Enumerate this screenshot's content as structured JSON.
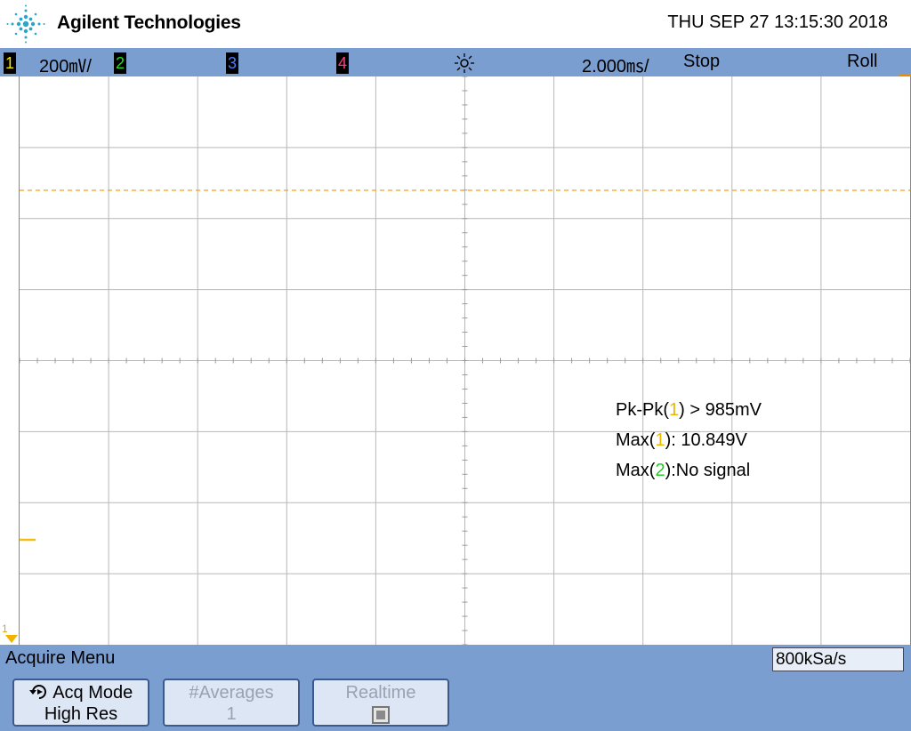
{
  "header": {
    "brand": "Agilent Technologies",
    "datetime": "THU SEP 27 13:15:30 2018",
    "logo_icon": "agilent-spark-icon"
  },
  "status": {
    "ch1": "1",
    "ch1_scale": "200㎷/",
    "ch2": "2",
    "ch3": "3",
    "ch4": "4",
    "trigger_icon": "trigger-sun-icon",
    "timebase": "2.000㎳/",
    "run_state": "Stop",
    "mode": "Roll",
    "colors": {
      "ch1": "#f5e600",
      "ch2": "#22dd22",
      "ch3": "#4a7bff",
      "ch4": "#ff3d8a"
    }
  },
  "screen": {
    "ground_marker": "1",
    "trace_color": "#f2c010"
  },
  "measurements": {
    "pkpk_label": "Pk-Pk(",
    "pkpk_ch": "1",
    "pkpk_value": ") > 985mV",
    "max1_label": "Max(",
    "max1_ch": "1",
    "max1_value": "): 10.849V",
    "max2_label": "Max(",
    "max2_ch": "2",
    "max2_value": "):No signal"
  },
  "menu": {
    "title": "Acquire Menu",
    "sample_rate": "800kSa/s",
    "acq_mode_label": "Acq Mode",
    "acq_mode_value": "High Res",
    "averages_label": "#Averages",
    "averages_value": "1",
    "realtime_label": "Realtime"
  }
}
